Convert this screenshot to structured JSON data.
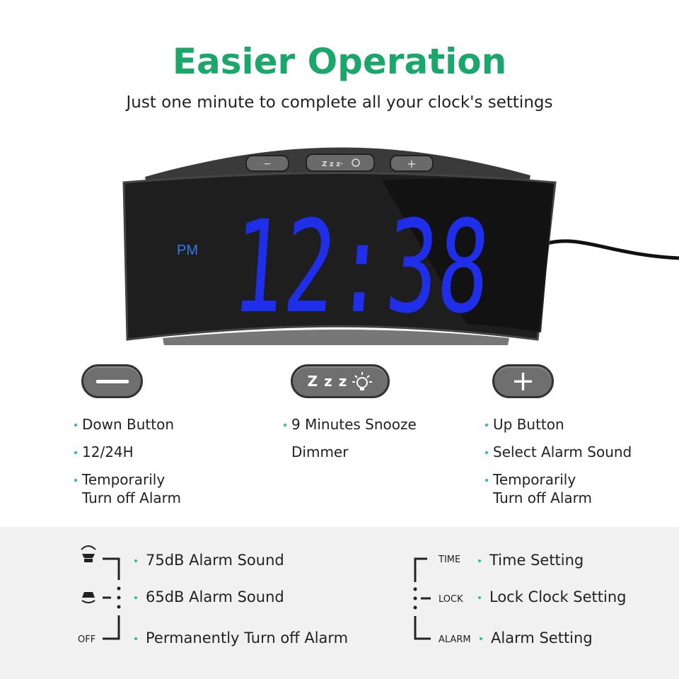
{
  "header": {
    "title": "Easier Operation",
    "subtitle": "Just one minute to complete all your clock's settings"
  },
  "clock": {
    "time": "12:38",
    "period": "PM",
    "digit_color": "#1f2ee8",
    "top_buttons": [
      "−",
      "Zz",
      "+"
    ]
  },
  "buttons": {
    "down": {
      "icon": "minus-icon",
      "items": [
        "Down Button",
        "12/24H",
        "Temporarily Turn off Alarm"
      ]
    },
    "snooze": {
      "icon": "snooze-dimmer-icon",
      "label": "Z z z",
      "items": [
        "9 Minutes Snooze",
        "Dimmer"
      ]
    },
    "up": {
      "icon": "plus-icon",
      "items": [
        "Up Button",
        "Select Alarm Sound",
        "Temporarily Turn off Alarm"
      ]
    }
  },
  "alarm_switch": {
    "positions": [
      {
        "icon": "loud-speaker-icon",
        "label": "75dB Alarm Sound"
      },
      {
        "icon": "quiet-speaker-icon",
        "label": "65dB Alarm Sound"
      },
      {
        "switch_label": "OFF",
        "label": "Permanently Turn off Alarm"
      }
    ]
  },
  "mode_switch": {
    "positions": [
      {
        "switch_label": "TIME",
        "label": "Time Setting"
      },
      {
        "switch_label": "LOCK",
        "label": "Lock Clock Setting"
      },
      {
        "switch_label": "ALARM",
        "label": "Alarm Setting"
      }
    ]
  },
  "colors": {
    "accent": "#1aa86a",
    "bullet": "#1ec48a",
    "band": "#f1f1f1"
  }
}
